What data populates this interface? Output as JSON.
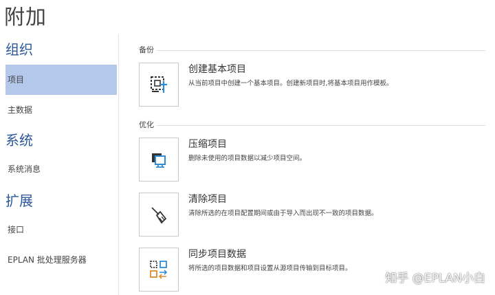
{
  "page_title": "附加",
  "sidebar": {
    "sections": [
      {
        "title": "组织",
        "items": [
          {
            "label": "项目",
            "selected": true
          },
          {
            "label": "主数据",
            "selected": false
          }
        ]
      },
      {
        "title": "系统",
        "items": [
          {
            "label": "系统消息",
            "selected": false
          }
        ]
      },
      {
        "title": "扩展",
        "items": [
          {
            "label": "接口",
            "selected": false
          },
          {
            "label": "EPLAN 批处理服务器",
            "selected": false
          }
        ]
      }
    ]
  },
  "groups": [
    {
      "title": "备份",
      "commands": [
        {
          "title": "创建基本项目",
          "description": "从当前项目中创建一个基本项目。创建新项目时,将基本项目用作模板。",
          "icon": "base-project-icon"
        }
      ]
    },
    {
      "title": "优化",
      "commands": [
        {
          "title": "压缩项目",
          "description": "删除未使用的项目数据以减少项目空间。",
          "icon": "compress-project-icon"
        },
        {
          "title": "清除项目",
          "description": "清除所选的在项目配置期间或由于导入而出现不一致的项目数据。",
          "icon": "broom-icon"
        },
        {
          "title": "同步项目数据",
          "description": "将所选的项目数据和项目设置从源项目传输到目标项目。",
          "icon": "sync-project-icon"
        }
      ]
    }
  ],
  "watermark": "知乎 @EPLAN小白",
  "colors": {
    "accent": "#2b579a",
    "selected_bg": "#b4c8ec",
    "icon_blue": "#2e8bd6",
    "icon_orange": "#e08a2c"
  }
}
